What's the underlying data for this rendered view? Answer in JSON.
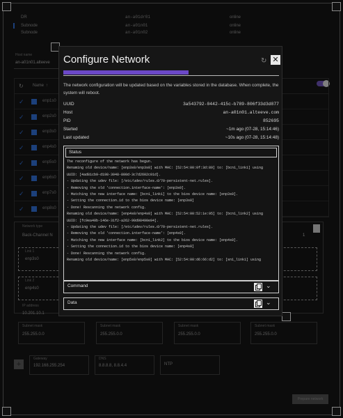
{
  "background": {
    "nodes": [
      {
        "role": "DR",
        "name": "an-a01dr01",
        "state": "online"
      },
      {
        "role": "Subnode",
        "name": "an-a01n01",
        "state": "online"
      },
      {
        "role": "Subnode",
        "name": "an-a01n02",
        "state": "online"
      }
    ],
    "host_label": "Host name",
    "host_value": "an-a01n01.alteeve",
    "table_header": "Name",
    "interfaces": [
      "enp1s0",
      "enp2s0",
      "enp3s0",
      "enp4s0",
      "enp5s0",
      "enp6s0",
      "enp7s0",
      "enp8s0"
    ],
    "network_type_label": "Network type",
    "network_type_value": "Back-Channel N",
    "iface1_label": "Link 1",
    "iface1_value": "enp3s0",
    "iface2_label": "Link 2",
    "iface2_value": "enp4s0",
    "ip_label": "IP address",
    "ip_value": "10.201.10.1",
    "subnet_label": "Subnet mask",
    "subnet_value": "255.255.0.0",
    "gateway_label": "Gateway",
    "gateway_value": "192.168.255.254",
    "dns_label": "DNS",
    "dns_value": "8.8.8.8, 8.8.4.4",
    "ntp_placeholder": "NTP",
    "add_button": "+",
    "prepare_button": "Prepare network",
    "one": "1"
  },
  "dialog": {
    "title": "Configure Network",
    "progress": 0.58,
    "description": "The network configuration will be updated based on the variables stored in the database. When complete, the system will reboot.",
    "info": [
      {
        "key": "UUID",
        "value": "3a543792-0442-415c-b789-806f33d3d877",
        "mono": true
      },
      {
        "key": "Host",
        "value": "an-a01n01.alteeve.com",
        "mono": true
      },
      {
        "key": "PID",
        "value": "852695",
        "mono": true
      },
      {
        "key": "Started",
        "value": "~1m ago (07-28, 15:14:46)",
        "mono": false
      },
      {
        "key": "Last updated",
        "value": "~10s ago (07-28, 15:14:48)",
        "mono": false
      }
    ],
    "status_label": "Status",
    "log": [
      "The reconfigure of the network has begun.",
      "Renaming old device/name: [enp3s0/enp3s0] with MAC: [52:54:00:0f:3d:89] to: [bcn1_link1] using",
      "UUID: [4ad81cb9-d198-3048-800d-3c7d2602c01d].",
      "- Updating the udev file: [/etc/udev/rules.d/70-persistent-net.rules].",
      "- Removing the old 'connection.interface-name': [enp3s0].",
      "- Matching the new interface name: [bcn1_link1] to the bios device name: [enp3s0].",
      "- Setting the connection.id to the bios device name: [enp3s0]",
      "  - Done! Rescanning the network config.",
      "Renaming old device/name: [enp4s0/enp4s0] with MAC: [52:54:00:52:1e:95] to: [bcn1_link2] using",
      "UUID: [fc9ea40b-146e-31f2-a262-90d98490e94].",
      "- Updating the udev file: [/etc/udev/rules.d/70-persistent-net.rules].",
      "- Removing the old 'connection.interface-name': [enp4s0].",
      "- Matching the new interface name: [bcn1_link2] to the bios device name: [enp4s0].",
      "- Setting the connection.id to the bios device name: [enp4s0]",
      "  - Done! Rescanning the network config.",
      "Renaming old device/name: [enp5s0/enp5s0] with MAC: [52:54:00:d6:66:d2] to: [sn1_link1] using"
    ],
    "command_label": "Command",
    "data_label": "Data"
  }
}
